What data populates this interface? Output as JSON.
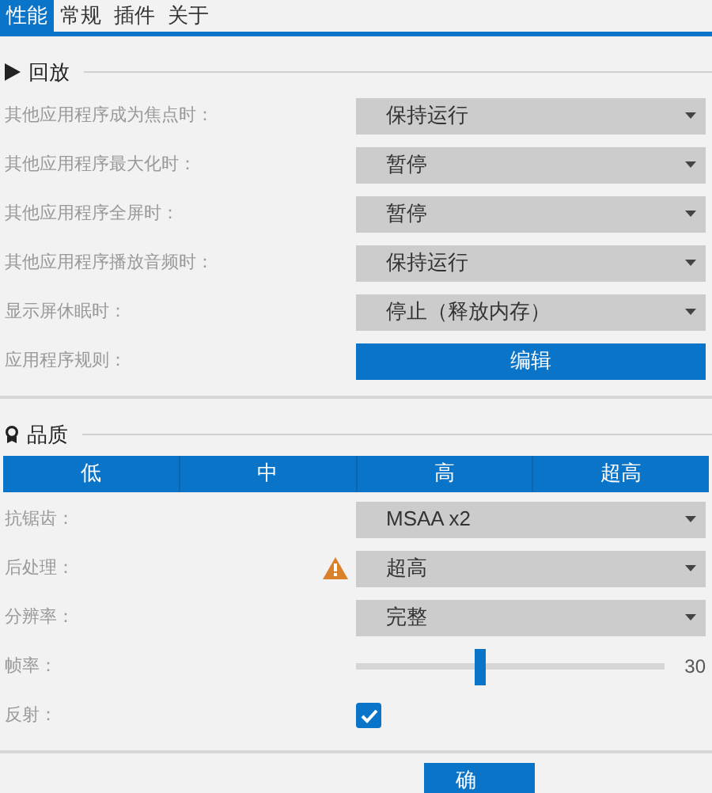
{
  "tabs": [
    {
      "label": "性能",
      "selected": true
    },
    {
      "label": "常规",
      "selected": false
    },
    {
      "label": "插件",
      "selected": false
    },
    {
      "label": "关于",
      "selected": false
    }
  ],
  "sections": [
    {
      "title": "回放",
      "rows": [
        {
          "kind": "select",
          "label": "其他应用程序成为焦点时：",
          "value": "保持运行",
          "warning": false
        },
        {
          "kind": "select",
          "label": "其他应用程序最大化时：",
          "value": "暂停",
          "warning": false
        },
        {
          "kind": "select",
          "label": "其他应用程序全屏时：",
          "value": "暂停",
          "warning": false
        },
        {
          "kind": "select",
          "label": "其他应用程序播放音频时：",
          "value": "保持运行",
          "warning": false
        },
        {
          "kind": "select",
          "label": "显示屏休眠时：",
          "value": "停止（释放内存）",
          "warning": false
        },
        {
          "kind": "button",
          "label": "应用程序规则：",
          "value": "编辑"
        }
      ]
    },
    {
      "title": "品质",
      "presets": [
        "低",
        "中",
        "高",
        "超高"
      ],
      "rows": [
        {
          "kind": "select",
          "label": "抗锯齿：",
          "value": "MSAA x2",
          "warning": false
        },
        {
          "kind": "select",
          "label": "后处理：",
          "value": "超高",
          "warning": true
        },
        {
          "kind": "select",
          "label": "分辨率：",
          "value": "完整",
          "warning": false
        },
        {
          "kind": "slider",
          "label": "帧率：",
          "level": 0.4,
          "reading": "30"
        },
        {
          "kind": "checkbox",
          "label": "反射：",
          "checked": true
        }
      ]
    }
  ],
  "confirm_button": "确"
}
